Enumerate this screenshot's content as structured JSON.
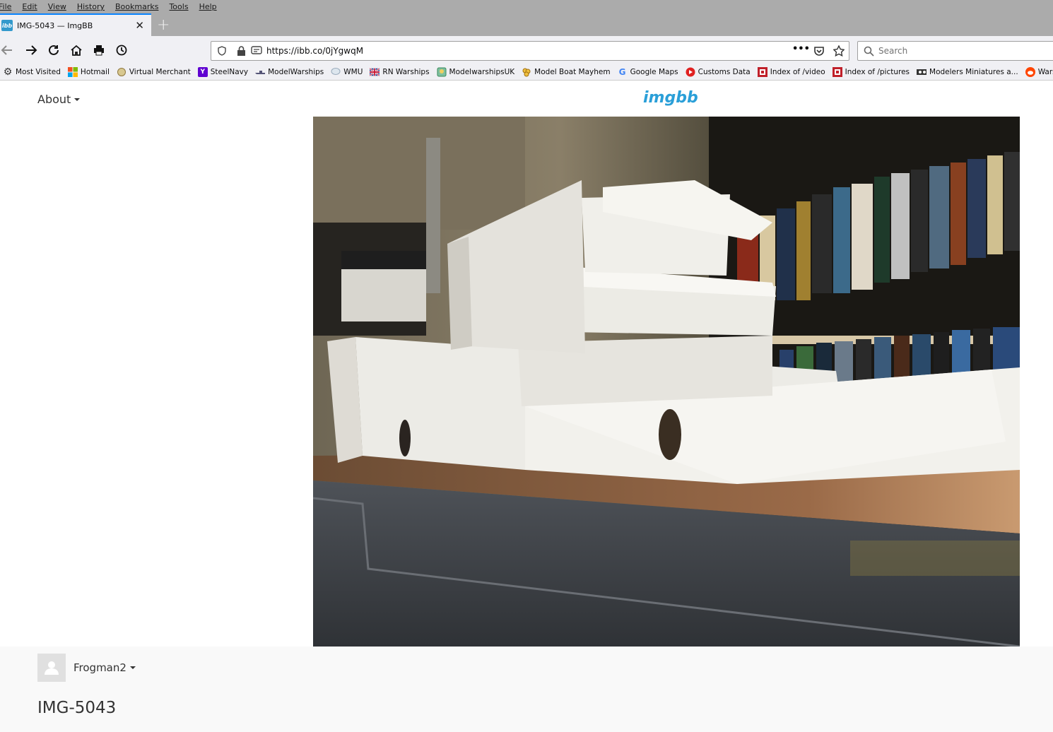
{
  "menubar": {
    "items": [
      "File",
      "Edit",
      "View",
      "History",
      "Bookmarks",
      "Tools",
      "Help"
    ]
  },
  "tab": {
    "favicon": "ibb",
    "title": "IMG-5043 — ImgBB",
    "close_glyph": "✕",
    "new_tab_glyph": "+"
  },
  "navbar": {
    "url": "https://ibb.co/0jYgwqM",
    "page_actions_glyph": "•••",
    "search_placeholder": "Search"
  },
  "bookmarks": [
    {
      "label": "Most Visited",
      "icon": "gear-icon",
      "color": "#444444"
    },
    {
      "label": "Hotmail",
      "icon": "windows-icon",
      "color": "#f25022"
    },
    {
      "label": "Virtual Merchant",
      "icon": "globe-icon",
      "color": "#b8a060"
    },
    {
      "label": "SteelNavy",
      "icon": "yahoo-icon",
      "color": "#5f01d1"
    },
    {
      "label": "ModelWarships",
      "icon": "ship-icon",
      "color": "#555577"
    },
    {
      "label": "WMU",
      "icon": "chat-icon",
      "color": "#9ab"
    },
    {
      "label": "RN Warships",
      "icon": "union-jack-icon",
      "color": "#1b3a8c"
    },
    {
      "label": "ModelwarshipsUK",
      "icon": "badge-icon",
      "color": "#3a8a5a"
    },
    {
      "label": "Model Boat Mayhem",
      "icon": "cluster-icon",
      "color": "#e0a020"
    },
    {
      "label": "Google Maps",
      "icon": "google-icon",
      "color": "#4285f4"
    },
    {
      "label": "Customs Data",
      "icon": "play-icon",
      "color": "#e02020"
    },
    {
      "label": "Index of /video",
      "icon": "folder-icon",
      "color": "#c0202a"
    },
    {
      "label": "Index of /pictures",
      "icon": "folder-icon",
      "color": "#c0202a"
    },
    {
      "label": "Modelers Miniatures a...",
      "icon": "mm-icon",
      "color": "#333333"
    },
    {
      "label": "WarshipPorn",
      "icon": "reddit-icon",
      "color": "#ff4500"
    }
  ],
  "page": {
    "about_label": "About",
    "logo": "imgbb",
    "photo_alt": "IMG-5043",
    "uploader": "Frogman2",
    "image_title": "IMG-5043"
  }
}
